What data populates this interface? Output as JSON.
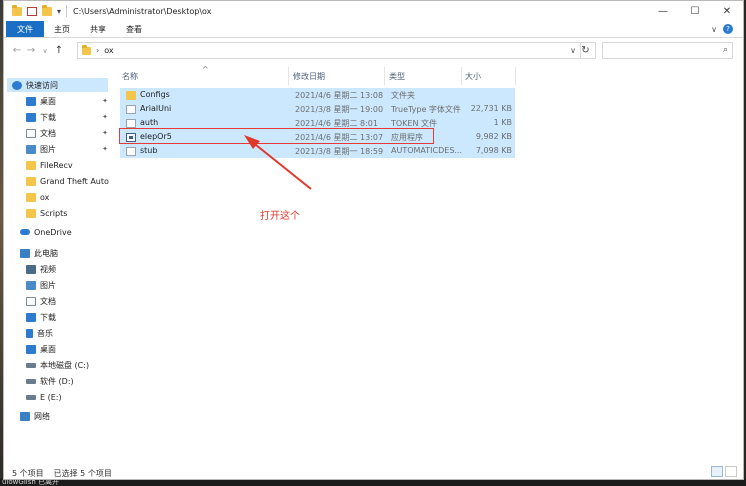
{
  "window": {
    "path": "C:\\Users\\Administrator\\Desktop\\ox",
    "controls": {
      "minimize": "—",
      "maximize": "☐",
      "close": "✕"
    }
  },
  "ribbon": {
    "tabs": [
      "文件",
      "主页",
      "共享",
      "查看"
    ],
    "help": "?",
    "chevron": "∨"
  },
  "nav": {
    "back": "←",
    "forward": "→",
    "recent": "∨",
    "up": "↑"
  },
  "address": {
    "crumbs": [
      "ox"
    ],
    "separator": "›",
    "dropdown": "∨",
    "refresh": "↻"
  },
  "search": {
    "icon": "⌕"
  },
  "sidebar": {
    "items": [
      {
        "label": "快速访问",
        "icon": "star-icon",
        "color": "#2d7bd0",
        "selected": true
      },
      {
        "label": "桌面",
        "icon": "desktop-icon",
        "color": "#2d7bd0",
        "pinned": true
      },
      {
        "label": "下载",
        "icon": "download-icon",
        "color": "#2d7bd0",
        "pinned": true
      },
      {
        "label": "文档",
        "icon": "document-icon",
        "color": "#7a8a99",
        "pinned": true
      },
      {
        "label": "图片",
        "icon": "pictures-icon",
        "color": "#4a8ac8",
        "pinned": true
      },
      {
        "label": "FileRecv",
        "icon": "folder-icon",
        "color": "#f3c64b"
      },
      {
        "label": "Grand Theft Auto",
        "icon": "folder-icon",
        "color": "#f3c64b"
      },
      {
        "label": "ox",
        "icon": "folder-icon",
        "color": "#f3c64b"
      },
      {
        "label": "Scripts",
        "icon": "folder-icon",
        "color": "#f3c64b"
      },
      {
        "label": "OneDrive",
        "icon": "cloud-icon",
        "color": "#2d7bd0"
      },
      {
        "label": "此电脑",
        "icon": "computer-icon",
        "color": "#3b7fc4"
      },
      {
        "label": "视频",
        "icon": "video-icon",
        "color": "#4a6a8a"
      },
      {
        "label": "图片",
        "icon": "pictures-icon",
        "color": "#4a8ac8"
      },
      {
        "label": "文档",
        "icon": "document-icon",
        "color": "#7a8a99"
      },
      {
        "label": "下载",
        "icon": "download-icon",
        "color": "#2d7bd0"
      },
      {
        "label": "音乐",
        "icon": "music-icon",
        "color": "#2d7bd0"
      },
      {
        "label": "桌面",
        "icon": "desktop-icon",
        "color": "#2d7bd0"
      },
      {
        "label": "本地磁盘 (C:)",
        "icon": "drive-icon",
        "color": "#6b7c8c"
      },
      {
        "label": "软件 (D:)",
        "icon": "drive-icon",
        "color": "#6b7c8c"
      },
      {
        "label": "E (E:)",
        "icon": "drive-icon",
        "color": "#6b7c8c"
      },
      {
        "label": "网络",
        "icon": "network-icon",
        "color": "#3b7fc4"
      }
    ],
    "pin_glyph": "📌"
  },
  "columns": {
    "name": "名称",
    "date": "修改日期",
    "type": "类型",
    "size": "大小",
    "sort_glyph": "^"
  },
  "files": [
    {
      "name": "Configs",
      "date": "2021/4/6 星期二 13:08",
      "type": "文件夹",
      "size": "",
      "kind": "folder"
    },
    {
      "name": "ArialUni",
      "date": "2021/3/8 星期一 19:00",
      "type": "TrueType 字体文件",
      "size": "22,731 KB",
      "kind": "file"
    },
    {
      "name": "auth",
      "date": "2021/4/6 星期二 8:01",
      "type": "TOKEN 文件",
      "size": "1 KB",
      "kind": "file"
    },
    {
      "name": "elepOr5",
      "date": "2021/4/6 星期二 13:07",
      "type": "应用程序",
      "size": "9,982 KB",
      "kind": "exe"
    },
    {
      "name": "stub",
      "date": "2021/3/8 星期一 18:59",
      "type": "AUTOMATICDES...",
      "size": "7,098 KB",
      "kind": "file"
    }
  ],
  "annotation": {
    "text": "打开这个",
    "color": "#e0392c"
  },
  "status": {
    "count": "5 个项目",
    "selected": "已选择 5 个项目"
  },
  "behind": {
    "text": "ulowGlish 已离开"
  }
}
